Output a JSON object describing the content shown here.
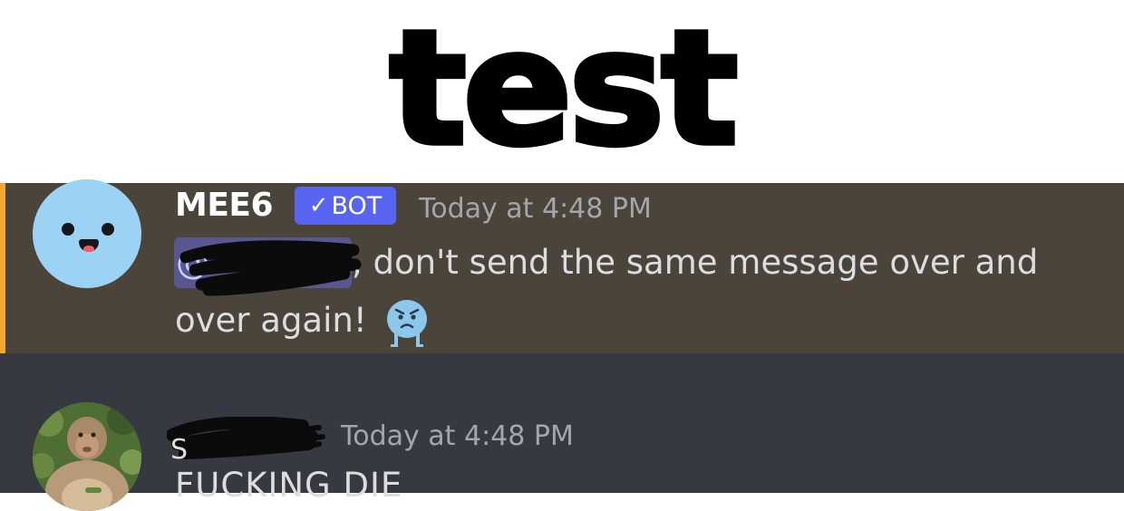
{
  "caption": {
    "text": "test"
  },
  "messages": [
    {
      "username": "MEE6",
      "badge": "BOT",
      "timestamp": "Today at 4:48 PM",
      "mention_prefix": "@",
      "text_line1": ", don't send the same message over and",
      "text_line2": "over again!",
      "emoji": "angry-blob-icon",
      "avatar": "mee6-smiley-avatar",
      "accent_color": "#f0a832"
    },
    {
      "username_initial": "S",
      "timestamp": "Today at 4:48 PM",
      "text": "FUCKING DIE",
      "avatar": "monkey-photo-avatar"
    }
  ],
  "colors": {
    "mention_highlight_bg": "#4a443a",
    "chat_bg": "#36393f",
    "bot_badge": "#5865f2",
    "mee6_avatar": "#9cd2f3"
  }
}
